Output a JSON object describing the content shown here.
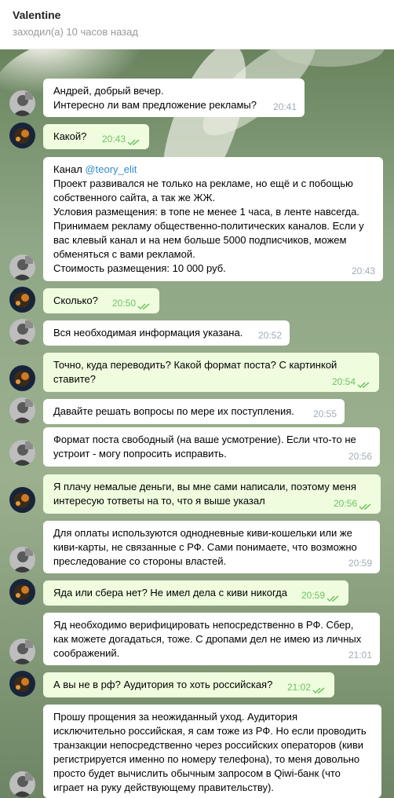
{
  "header": {
    "name": "Valentine",
    "status": "заходил(а) 10 часов назад"
  },
  "messages": [
    {
      "dir": "in",
      "text": "Андрей, добрый вечер.\nИнтересно ли вам предложение рекламы?",
      "time": "20:41"
    },
    {
      "dir": "out",
      "text": "Какой?",
      "time": "20:43"
    },
    {
      "dir": "in",
      "prefix": "Канал ",
      "link": "@teory_elit",
      "text": "\nПроект развивался не только на рекламе, но ещё и с побощью собственного сайта, а так же ЖЖ.\nУсловия размещения: в топе не менее 1 часа, в ленте навсегда. Принимаем рекламу общественно-политических каналов. Если у вас клевый канал и на нем больше 5000 подписчиков, можем обменяться с вами рекламой.\nСтоимость размещения: 10 000 руб.",
      "time": "20:43"
    },
    {
      "dir": "out",
      "text": "Сколько?",
      "time": "20:50"
    },
    {
      "dir": "in",
      "text": "Вся необходимая информация указана.",
      "time": "20:52"
    },
    {
      "dir": "out",
      "text": "Точно, куда переводить? Какой формат поста? С картинкой ставите?",
      "time": "20:54"
    },
    {
      "dir": "in",
      "text": "Давайте решать вопросы по мере их поступления.",
      "time": "20:55"
    },
    {
      "dir": "in",
      "text": "Формат поста свободный (на ваше усмотрение). Если что-то не устроит - могу попросить исправить.",
      "time": "20:56"
    },
    {
      "dir": "out",
      "text": "Я плачу немалые деньги, вы мне сами написали, поэтому меня интересую тответы на то, что я выше указал",
      "time": "20:56"
    },
    {
      "dir": "in",
      "text": "Для оплаты используются однодневные киви-кошельки или же киви-карты, не связанные с РФ. Сами понимаете, что возможно преследование со стороны властей.",
      "time": "20:59"
    },
    {
      "dir": "out",
      "text": "Яда или сбера нет? Не имел дела с киви никогда",
      "time": "20:59"
    },
    {
      "dir": "in",
      "text": "Яд необходимо верифицировать непосредственно в РФ. Сбер, как можете догадаться, тоже. С дропами дел не имею из личных соображений.",
      "time": "21:01"
    },
    {
      "dir": "out",
      "text": "А вы не в рф? Аудитория то хоть российская?",
      "time": "21:02"
    },
    {
      "dir": "in",
      "text": "Прошу прощения за неожиданный уход. Аудитория исключительно российская, я сам тоже из РФ. Но если проводить транзакции непосредственно через российских операторов (киви регистрируется именно по номеру телефона), то меня довольно просто будет вычислить обычным запросом в Qiwi-банк (что играет на руку действующему правительству).",
      "time": ""
    }
  ],
  "colors": {
    "incoming_bubble": "#ffffff",
    "outgoing_bubble": "#effdde",
    "outgoing_time": "#6cc264",
    "link": "#2f8bd0"
  }
}
